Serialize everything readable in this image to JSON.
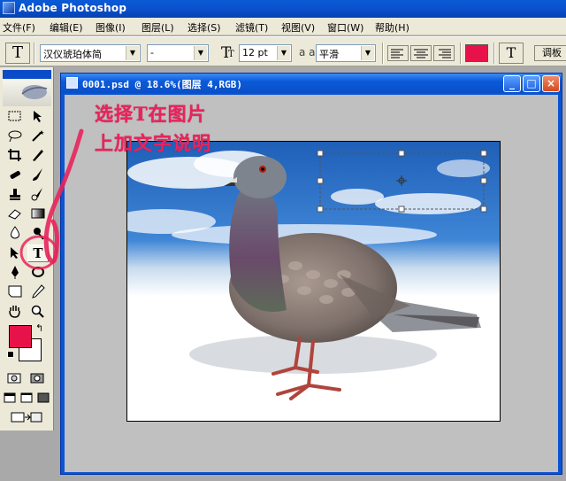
{
  "app": {
    "title": "Adobe Photoshop"
  },
  "menu": {
    "items": [
      "文件(F)",
      "编辑(E)",
      "图像(I)",
      "图层(L)",
      "选择(S)",
      "滤镜(T)",
      "视图(V)",
      "窗口(W)",
      "帮助(H)"
    ]
  },
  "options": {
    "tool_glyph": "T",
    "font_family": "汉仪琥珀体简",
    "font_style": "-",
    "font_size": "12 pt",
    "aa_label": "a a",
    "aa_value": "平滑",
    "color_swatch": "#e8124a",
    "palette_button": "调板"
  },
  "document": {
    "title": "0001.psd @ 18.6%(图层 4,RGB)",
    "min_label": "_",
    "max_label": "□",
    "close_label": "×"
  },
  "annotation": {
    "line1": "选择T在图片",
    "line2": "上加文字说明",
    "color": "#e8245c"
  },
  "colors": {
    "foreground": "#e8124a",
    "background": "#ffffff"
  },
  "toolbox": {
    "type_tool_label": "T"
  }
}
